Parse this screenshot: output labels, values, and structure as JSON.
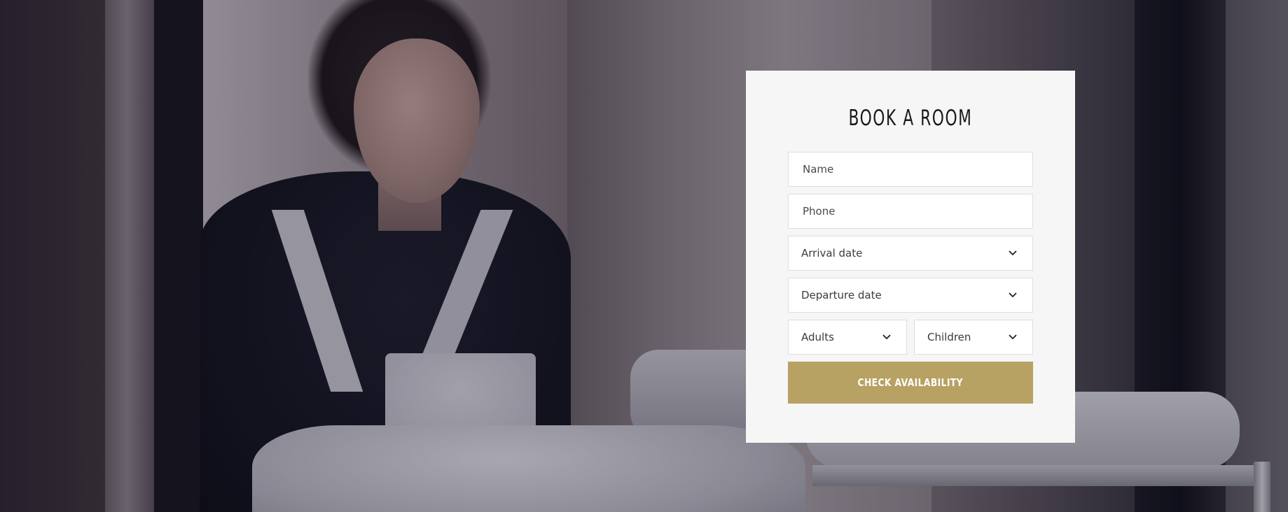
{
  "booking": {
    "title": "BOOK A ROOM",
    "name_placeholder": "Name",
    "phone_placeholder": "Phone",
    "arrival_label": "Arrival date",
    "departure_label": "Departure date",
    "adults_label": "Adults",
    "children_label": "Children",
    "check_button": "CHECK AVAILABILITY"
  },
  "icons": {
    "dropdown": "chevron-down-icon"
  },
  "colors": {
    "card_background": "#f6f6f6",
    "button_gold": "#b7a163",
    "field_border": "#dedede",
    "title_text": "#1a1a1a"
  }
}
